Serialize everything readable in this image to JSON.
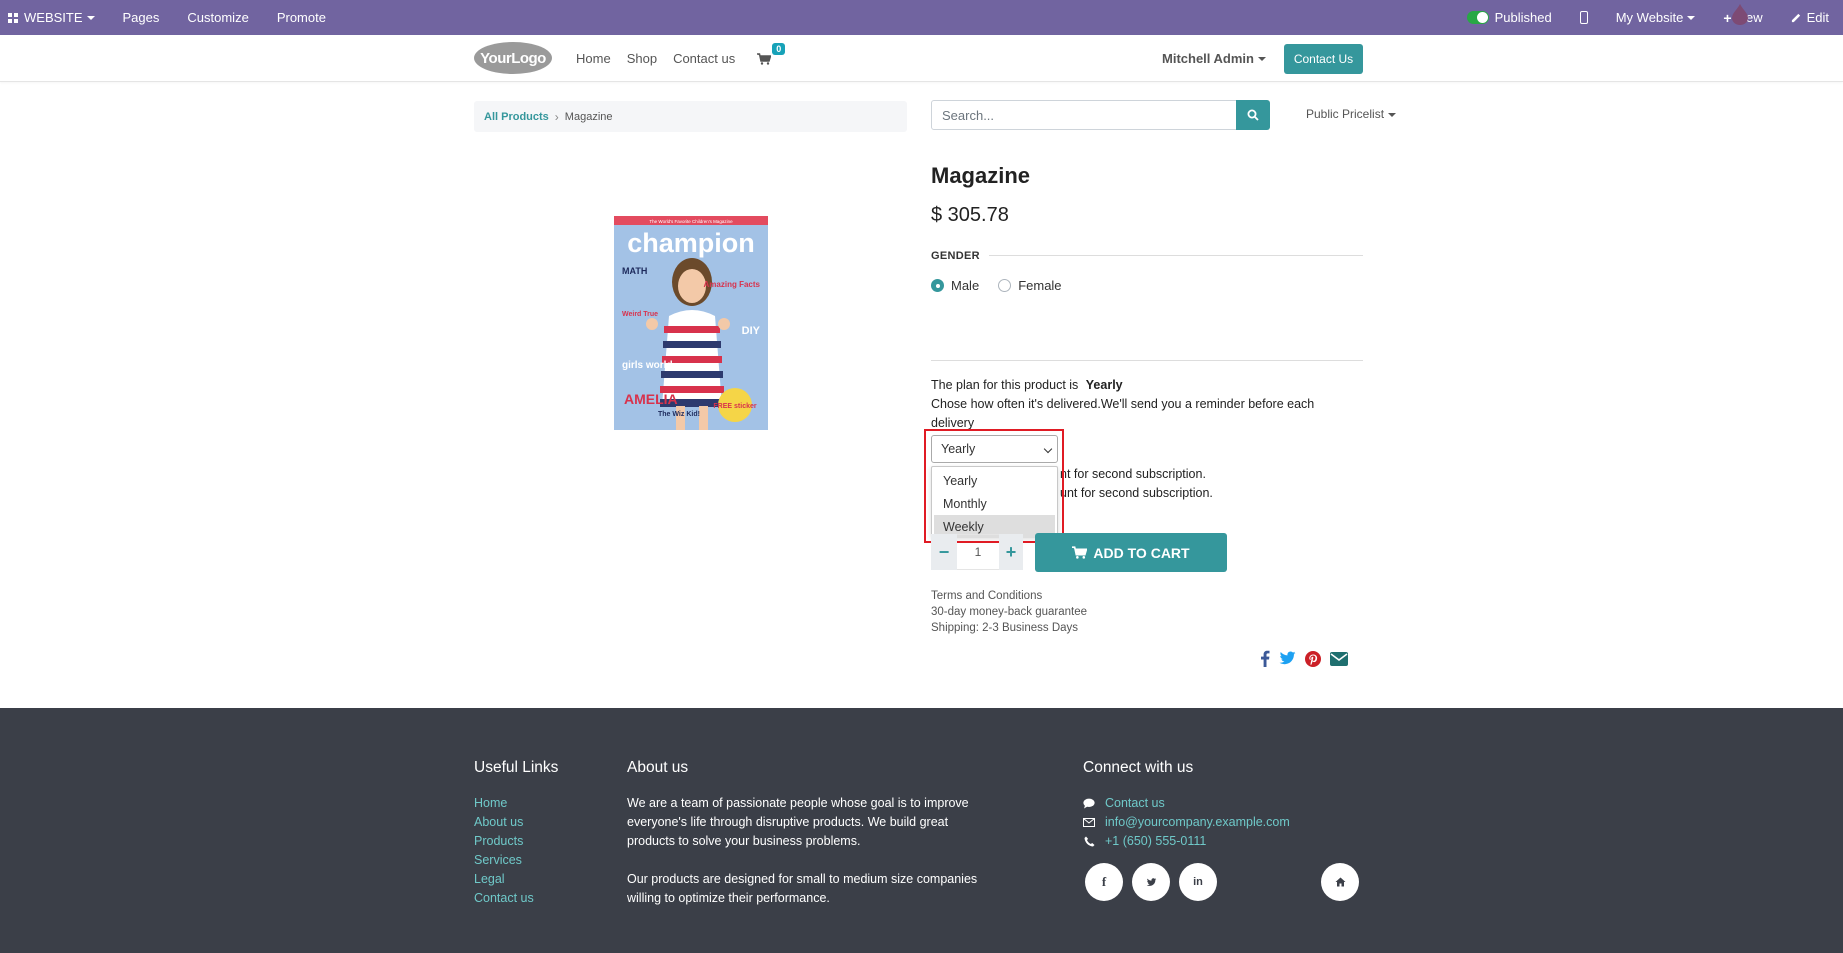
{
  "adminbar": {
    "website_menu": "WEBSITE",
    "pages": "Pages",
    "customize": "Customize",
    "promote": "Promote",
    "published": "Published",
    "my_website": "My Website",
    "new": "New",
    "edit": "Edit",
    "bg_color": "#7164a0"
  },
  "header": {
    "logo_text": "YourLogo",
    "nav": [
      "Home",
      "Shop",
      "Contact us"
    ],
    "cart_count": "0",
    "user": "Mitchell Admin",
    "contact_button": "Contact Us"
  },
  "breadcrumb": {
    "root": "All Products",
    "current": "Magazine"
  },
  "search": {
    "placeholder": "Search...",
    "pricelist": "Public Pricelist"
  },
  "product": {
    "title": "Magazine",
    "price": "$ 305.78",
    "attribute_label": "GENDER",
    "options": [
      "Male",
      "Female"
    ],
    "selected_option": "Male",
    "cover": {
      "masthead": "champion",
      "tagline": "The World's Favorite Children's Magazine",
      "labels": [
        "MATH",
        "Amazing Facts",
        "Weird True",
        "DIY",
        "girls world",
        "AMELIA",
        "The Wiz Kid!",
        "FREE sticker"
      ]
    },
    "plan_prefix": "The plan for this product is",
    "plan_value": "Yearly",
    "plan_desc": "Chose how often it's delivered.We'll send you a reminder before each delivery",
    "select_value": "Yearly",
    "select_options": [
      "Yearly",
      "Monthly",
      "Weekly"
    ],
    "highlighted_option": "Weekly",
    "discount_line_1": "nt for second subscription.",
    "discount_line_2": "unt for second subscription.",
    "quantity": "1",
    "add_to_cart": "ADD TO CART",
    "terms": [
      "Terms and Conditions",
      "30-day money-back guarantee",
      "Shipping: 2-3 Business Days"
    ]
  },
  "footer": {
    "useful_links_title": "Useful Links",
    "useful_links": [
      "Home",
      "About us",
      "Products",
      "Services",
      "Legal",
      "Contact us"
    ],
    "about_title": "About us",
    "about_p1": "We are a team of passionate people whose goal is to improve everyone's life through disruptive products. We build great products to solve your business problems.",
    "about_p2": "Our products are designed for small to medium size companies willing to optimize their performance.",
    "connect_title": "Connect with us",
    "contact_link": "Contact us",
    "email": "info@yourcompany.example.com",
    "phone": "+1 (650) 555-0111",
    "bg_color": "#3b3f48"
  },
  "colors": {
    "accent": "#35979c",
    "link": "#6fc9c9",
    "highlight": "#e01b24"
  }
}
